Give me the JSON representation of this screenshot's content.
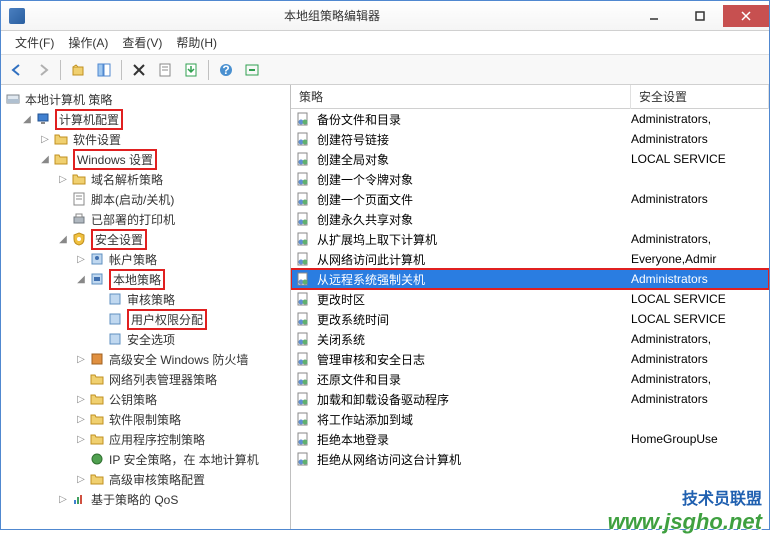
{
  "window": {
    "title": "本地组策略编辑器"
  },
  "menu": {
    "file": "文件(F)",
    "action": "操作(A)",
    "view": "查看(V)",
    "help": "帮助(H)"
  },
  "tree": {
    "root": "本地计算机 策略",
    "computer_config": "计算机配置",
    "software_settings": "软件设置",
    "windows_settings": "Windows 设置",
    "dns_policy": "域名解析策略",
    "scripts": "脚本(启动/关机)",
    "deployed_printers": "已部署的打印机",
    "security_settings": "安全设置",
    "account_policies": "帐户策略",
    "local_policies": "本地策略",
    "audit_policy": "审核策略",
    "user_rights": "用户权限分配",
    "security_options": "安全选项",
    "firewall": "高级安全 Windows 防火墙",
    "network_list": "网络列表管理器策略",
    "public_key": "公钥策略",
    "software_restrict": "软件限制策略",
    "app_control": "应用程序控制策略",
    "ip_security": "IP 安全策略，在 本地计算机",
    "advanced_audit": "高级审核策略配置",
    "qos": "基于策略的 QoS"
  },
  "list": {
    "header_name": "策略",
    "header_security": "安全设置",
    "items": [
      {
        "name": "备份文件和目录",
        "sec": "Administrators,"
      },
      {
        "name": "创建符号链接",
        "sec": "Administrators"
      },
      {
        "name": "创建全局对象",
        "sec": "LOCAL SERVICE"
      },
      {
        "name": "创建一个令牌对象",
        "sec": ""
      },
      {
        "name": "创建一个页面文件",
        "sec": "Administrators"
      },
      {
        "name": "创建永久共享对象",
        "sec": ""
      },
      {
        "name": "从扩展坞上取下计算机",
        "sec": "Administrators,"
      },
      {
        "name": "从网络访问此计算机",
        "sec": "Everyone,Admir"
      },
      {
        "name": "从远程系统强制关机",
        "sec": "Administrators",
        "selected": true,
        "redbox": true
      },
      {
        "name": "更改时区",
        "sec": "LOCAL SERVICE"
      },
      {
        "name": "更改系统时间",
        "sec": "LOCAL SERVICE"
      },
      {
        "name": "关闭系统",
        "sec": "Administrators,"
      },
      {
        "name": "管理审核和安全日志",
        "sec": "Administrators"
      },
      {
        "name": "还原文件和目录",
        "sec": "Administrators,"
      },
      {
        "name": "加载和卸载设备驱动程序",
        "sec": "Administrators"
      },
      {
        "name": "将工作站添加到域",
        "sec": ""
      },
      {
        "name": "拒绝本地登录",
        "sec": "HomeGroupUse"
      },
      {
        "name": "拒绝从网络访问这台计算机",
        "sec": ""
      }
    ]
  },
  "watermark": {
    "line1": "技术员联盟",
    "line2": "www.jsgho.net"
  }
}
